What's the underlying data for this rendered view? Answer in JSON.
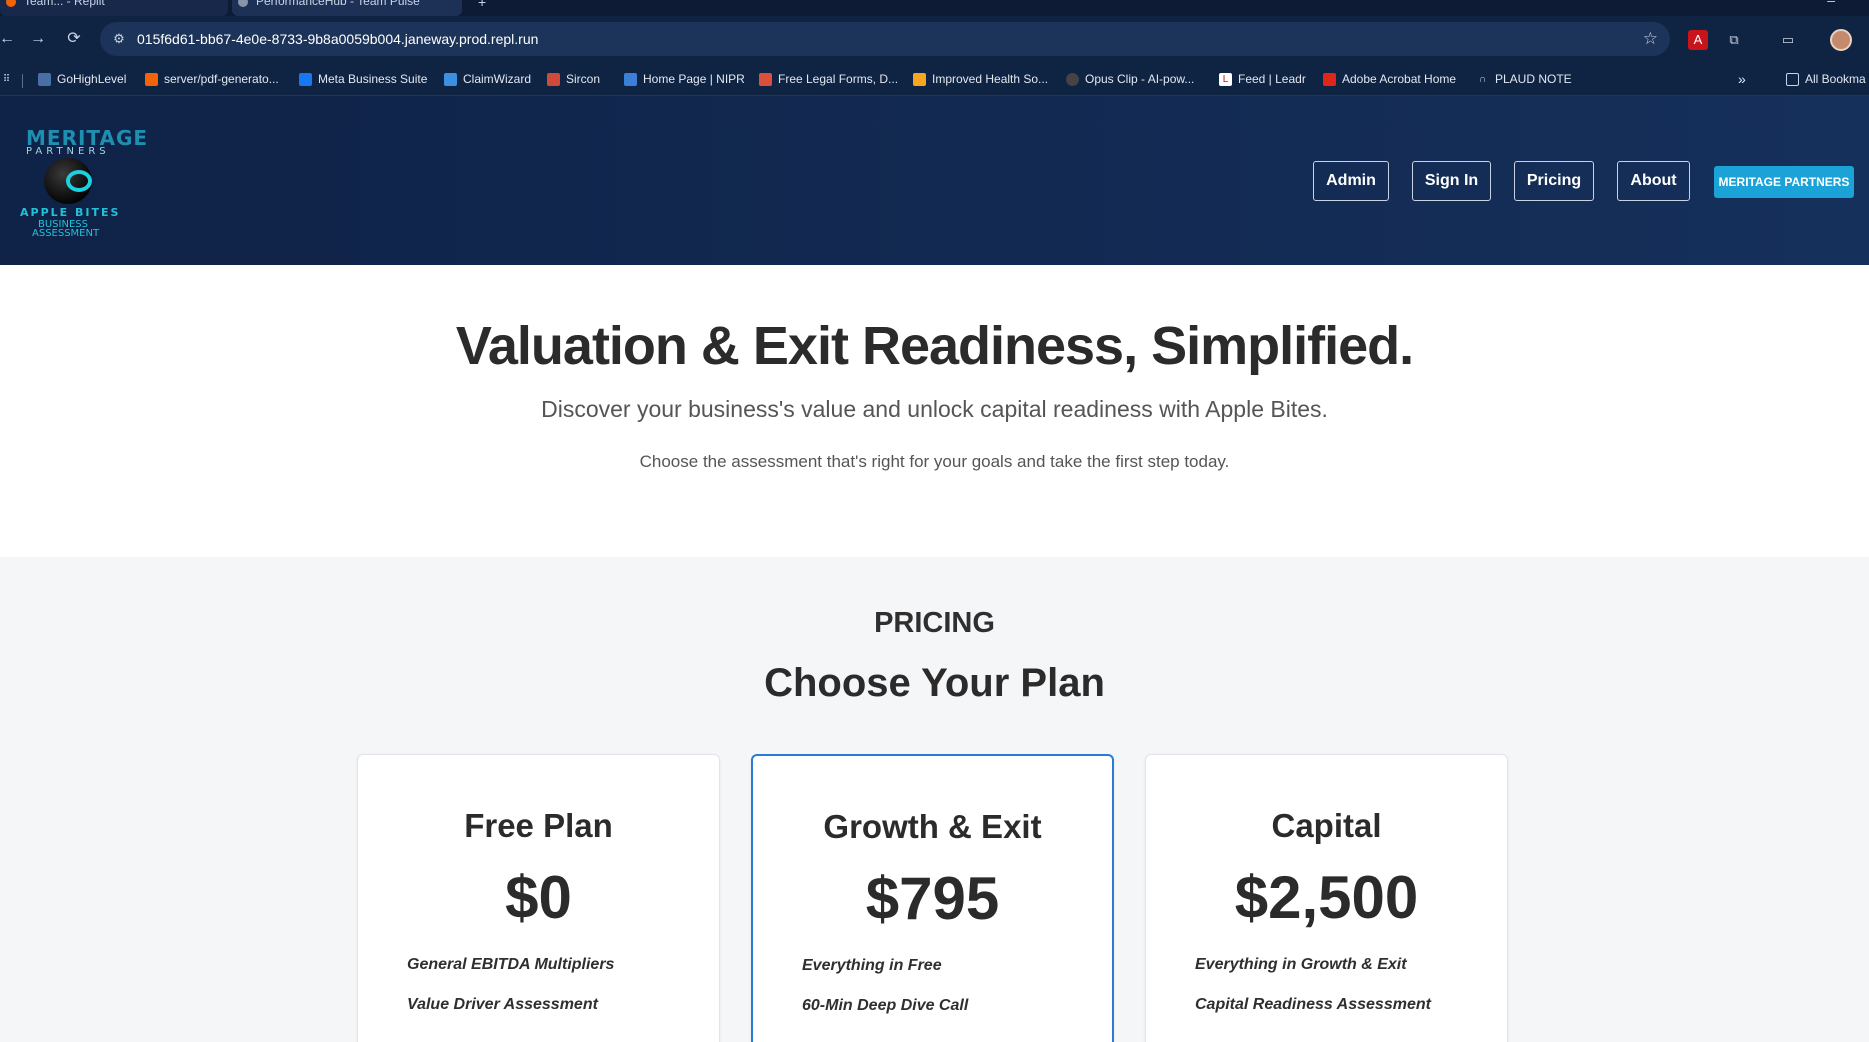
{
  "browser": {
    "tabs": [
      {
        "label": "Team... - Replit",
        "favicon_color": "#f26207"
      },
      {
        "label": "PerformanceHub - Team Pulse",
        "favicon_color": "#8a94a8"
      }
    ],
    "new_tab": "+",
    "url": "015f6d61-bb67-4e0e-8733-9b8a0059b004.janeway.prod.repl.run",
    "bookmarks": [
      {
        "label": "GoHighLevel",
        "icon": "gohighlevel-icon",
        "color": "#4a6fa5"
      },
      {
        "label": "server/pdf-generato...",
        "icon": "replit-icon",
        "color": "#f26207"
      },
      {
        "label": "Meta Business Suite",
        "icon": "meta-icon",
        "color": "#1877f2"
      },
      {
        "label": "ClaimWizard",
        "icon": "claimwizard-icon",
        "color": "#3d8fe0"
      },
      {
        "label": "Sircon",
        "icon": "sircon-icon",
        "color": "#d04a3a"
      },
      {
        "label": "Home Page | NIPR",
        "icon": "nipr-icon",
        "color": "#3d7fd6"
      },
      {
        "label": "Free Legal Forms, D...",
        "icon": "legal-forms-icon",
        "color": "#d9503f"
      },
      {
        "label": "Improved Health So...",
        "icon": "heart-shield-icon",
        "color": "#f5a623"
      },
      {
        "label": "Opus Clip - AI-pow...",
        "icon": "opus-clip-icon",
        "color": "#444444"
      },
      {
        "label": "Feed | Leadr",
        "icon": "leadr-icon",
        "color": "#ffffff"
      },
      {
        "label": "Adobe Acrobat Home",
        "icon": "adobe-acrobat-icon",
        "color": "#e0251b"
      },
      {
        "label": "PLAUD NOTE",
        "icon": "plaud-icon",
        "color": "#cccccc"
      }
    ],
    "more_bookmarks": "»",
    "all_bookmarks": "All Bookma"
  },
  "header": {
    "logo": {
      "line1": "MERITAGE",
      "line2": "PARTNERS",
      "line3": "APPLE BITES",
      "line4": "BUSINESS",
      "line5": "ASSESSMENT"
    },
    "nav": [
      "Admin",
      "Sign In",
      "Pricing",
      "About"
    ],
    "brand_button": "MERITAGE PARTNERS"
  },
  "hero": {
    "title": "Valuation & Exit Readiness, Simplified.",
    "subtitle": "Discover your business's value and unlock capital readiness with Apple Bites.",
    "tagline": "Choose the assessment that's right for your goals and take the first step today."
  },
  "pricing": {
    "eyebrow": "PRICING",
    "title": "Choose Your Plan",
    "plans": [
      {
        "name": "Free Plan",
        "price": "$0",
        "features": [
          "General EBITDA Multipliers",
          "Value Driver Assessment"
        ]
      },
      {
        "name": "Growth & Exit",
        "price": "$795",
        "features": [
          "Everything in Free",
          "60-Min Deep Dive Call"
        ]
      },
      {
        "name": "Capital",
        "price": "$2,500",
        "features": [
          "Everything in Growth & Exit",
          "Capital Readiness Assessment"
        ]
      }
    ]
  },
  "colors": {
    "header_bg": "#0f2247",
    "brand_button": "#1ba3d8",
    "featured_border": "#2b7bd3",
    "text_dark": "#2b2b2b"
  }
}
